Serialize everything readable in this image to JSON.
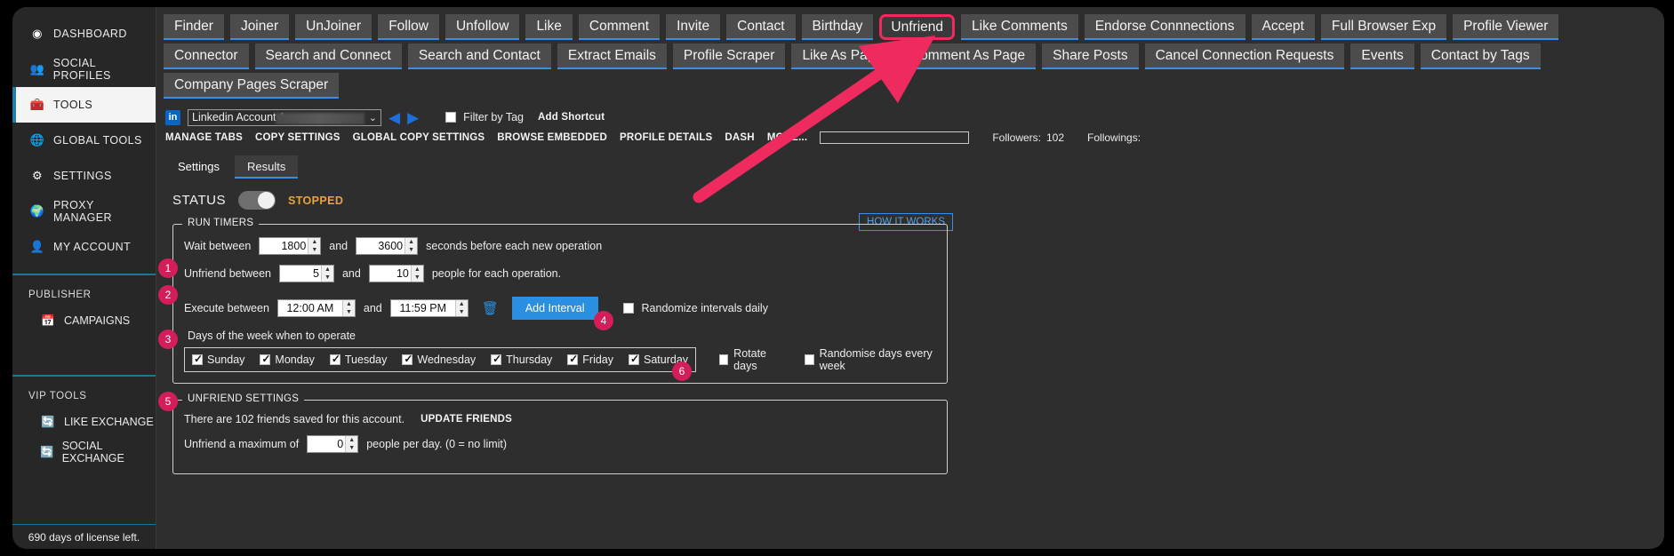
{
  "sidebar": {
    "items": [
      {
        "label": "DASHBOARD",
        "icon": "compass-icon",
        "active": false
      },
      {
        "label": "SOCIAL PROFILES",
        "icon": "people-icon",
        "active": false
      },
      {
        "label": "TOOLS",
        "icon": "briefcase-icon",
        "active": true
      },
      {
        "label": "GLOBAL TOOLS",
        "icon": "globe-tools-icon",
        "active": false
      },
      {
        "label": "SETTINGS",
        "icon": "gear-icon",
        "active": false
      },
      {
        "label": "PROXY MANAGER",
        "icon": "globe-icon",
        "active": false
      },
      {
        "label": "MY ACCOUNT",
        "icon": "user-icon",
        "active": false
      }
    ],
    "groups": [
      {
        "title": "PUBLISHER",
        "items": [
          {
            "label": "CAMPAIGNS",
            "icon": "calendar-icon"
          }
        ]
      },
      {
        "title": "VIP TOOLS",
        "items": [
          {
            "label": "LIKE EXCHANGE",
            "icon": "exchange-icon"
          },
          {
            "label": "SOCIAL EXCHANGE",
            "icon": "exchange-icon"
          }
        ]
      }
    ],
    "license": "690 days of license left."
  },
  "tabs": {
    "row1": [
      "Finder",
      "Joiner",
      "UnJoiner",
      "Follow",
      "Unfollow",
      "Like",
      "Comment",
      "Invite",
      "Contact",
      "Birthday",
      "Unfriend",
      "Like Comments",
      "Endorse Connnections",
      "Accept",
      "Full Browser Exp",
      "Profile Viewer"
    ],
    "row2": [
      "Connector",
      "Search and Connect",
      "Search and Contact",
      "Extract Emails",
      "Profile Scraper",
      "Like As Page",
      "Comment As Page",
      "Share Posts",
      "Cancel Connection Requests",
      "Events",
      "Contact by Tags"
    ],
    "row3": [
      "Company Pages Scraper"
    ],
    "selected": "Unfriend"
  },
  "toolbar": {
    "logo": "in",
    "account_value": "Linkedin Account 1 -",
    "prev_icon": "arrow-left-icon",
    "next_icon": "arrow-right-icon",
    "filter_by_tag": "Filter by Tag",
    "filter_checked": false,
    "add_shortcut": "Add Shortcut",
    "links": [
      "MANAGE TABS",
      "COPY SETTINGS",
      "GLOBAL COPY SETTINGS",
      "BROWSE EMBEDDED",
      "PROFILE DETAILS",
      "DASH",
      "MORE..."
    ],
    "search_value": "",
    "followers_label": "Followers:",
    "followers_count": "102",
    "followings_label": "Followings:",
    "followings_count": ""
  },
  "subtabs": {
    "items": [
      "Settings",
      "Results"
    ],
    "active": "Settings"
  },
  "status": {
    "label": "STATUS",
    "value": "STOPPED",
    "toggle_on": false,
    "how_it_works": "HOW IT WORKS"
  },
  "run_timers": {
    "legend": "RUN TIMERS",
    "wait": {
      "label": "Wait between",
      "min": "1800",
      "and": "and",
      "max": "3600",
      "suffix": "seconds before each new operation"
    },
    "unfriend": {
      "label": "Unfriend between",
      "min": "5",
      "and": "and",
      "max": "10",
      "suffix": "people for each operation."
    },
    "execute": {
      "label": "Execute between",
      "from": "12:00 AM",
      "and": "and",
      "to": "11:59 PM",
      "delete_icon": "trash-icon",
      "add_interval": "Add Interval",
      "randomize_label": "Randomize intervals daily",
      "randomize_checked": false
    },
    "days": {
      "title": "Days of the week when to operate",
      "list": [
        {
          "label": "Sunday",
          "checked": true
        },
        {
          "label": "Monday",
          "checked": true
        },
        {
          "label": "Tuesday",
          "checked": true
        },
        {
          "label": "Wednesday",
          "checked": true
        },
        {
          "label": "Thursday",
          "checked": true
        },
        {
          "label": "Friday",
          "checked": true
        },
        {
          "label": "Saturday",
          "checked": true
        }
      ],
      "rotate_days": "Rotate days",
      "rotate_checked": false,
      "randomise_week": "Randomise days every week",
      "randomise_checked": false
    }
  },
  "unfriend_settings": {
    "legend": "UNFRIEND SETTINGS",
    "friends_text": "There are 102 friends saved for this account.",
    "update_friends": "UPDATE FRIENDS",
    "max_label": "Unfriend a maximum of",
    "max_value": "0",
    "max_suffix": "people per day. (0 = no limit)"
  },
  "badges": [
    "1",
    "2",
    "3",
    "4",
    "5",
    "6"
  ],
  "colors": {
    "accent_pink": "#ef2a5f",
    "badge": "#d31e5a",
    "blue": "#2a8fe0",
    "tab_underline": "#3a8ee6",
    "status_orange": "#e8a33d",
    "sidebar_rule": "#17789c"
  }
}
